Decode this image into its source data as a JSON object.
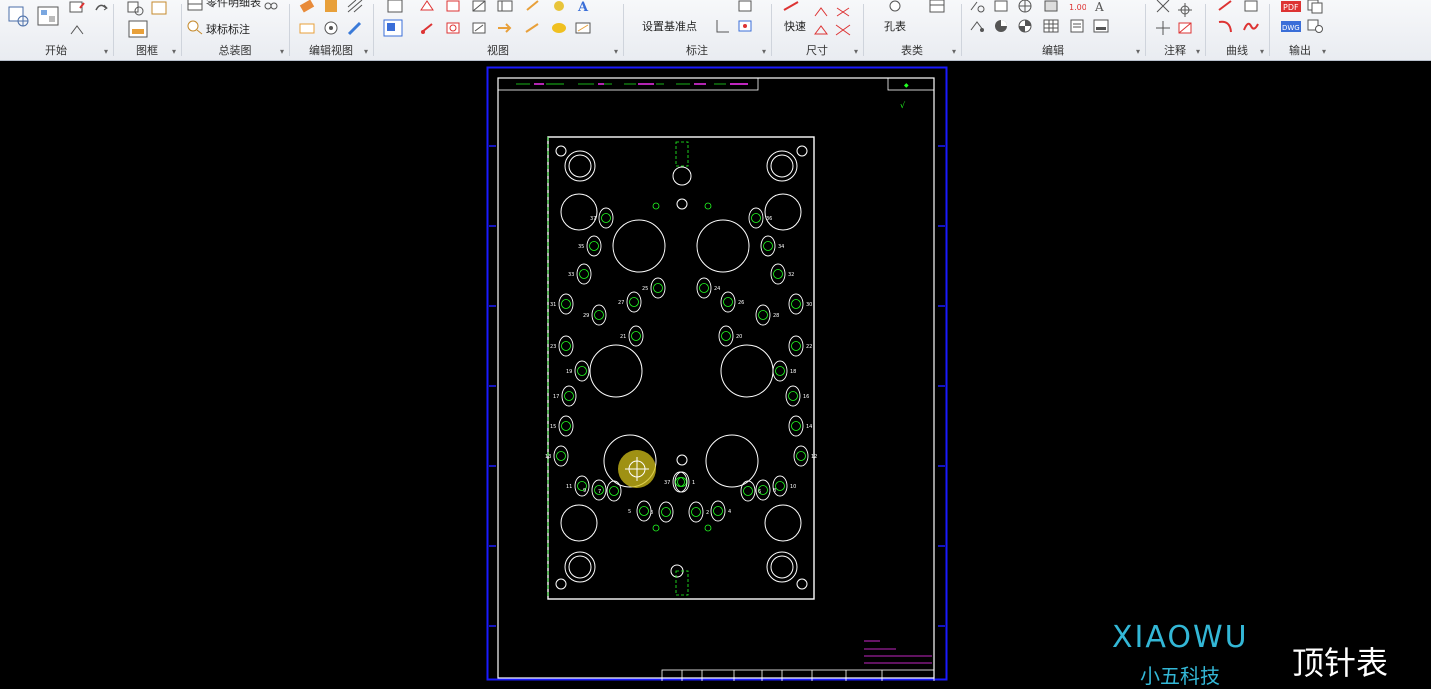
{
  "ribbon": {
    "groups": [
      {
        "id": "start",
        "label": "开始"
      },
      {
        "id": "frame",
        "label": "图框"
      },
      {
        "id": "assembly",
        "label": "总装图"
      },
      {
        "id": "edit-view",
        "label": "编辑视图"
      },
      {
        "id": "view",
        "label": "视图"
      },
      {
        "id": "annotation",
        "label": "标注"
      },
      {
        "id": "dimension",
        "label": "尺寸"
      },
      {
        "id": "table",
        "label": "表类"
      },
      {
        "id": "edit",
        "label": "编辑"
      },
      {
        "id": "note",
        "label": "注释"
      },
      {
        "id": "curve",
        "label": "曲线"
      },
      {
        "id": "output",
        "label": "输出"
      }
    ],
    "commands": {
      "part_detail": "零件明细表",
      "balloon": "球标标注",
      "set_datum": "设置基准点",
      "quick": "快速",
      "hole_table": "孔表"
    }
  },
  "drawing": {
    "title_text": "顶针表",
    "pin_labels_left": [
      "37",
      "36",
      "35",
      "34",
      "33",
      "32",
      "31",
      "30",
      "29",
      "28",
      "27",
      "26",
      "25",
      "24",
      "23",
      "22",
      "21",
      "20",
      "19",
      "18",
      "17",
      "16",
      "15",
      "14",
      "13",
      "12",
      "11",
      "10",
      "9",
      "8",
      "7",
      "6",
      "5",
      "4",
      "3",
      "2",
      "1"
    ]
  },
  "branding": {
    "logo": "XIAOWU",
    "logo_sub": "小五科技",
    "caption": "顶针表"
  },
  "colors": {
    "sheet_border": "#1a1aff",
    "plate": "#ffffff",
    "pin_text": "#22ff22",
    "note_text": "#ff33ff",
    "cursor": "#d4c21a"
  }
}
